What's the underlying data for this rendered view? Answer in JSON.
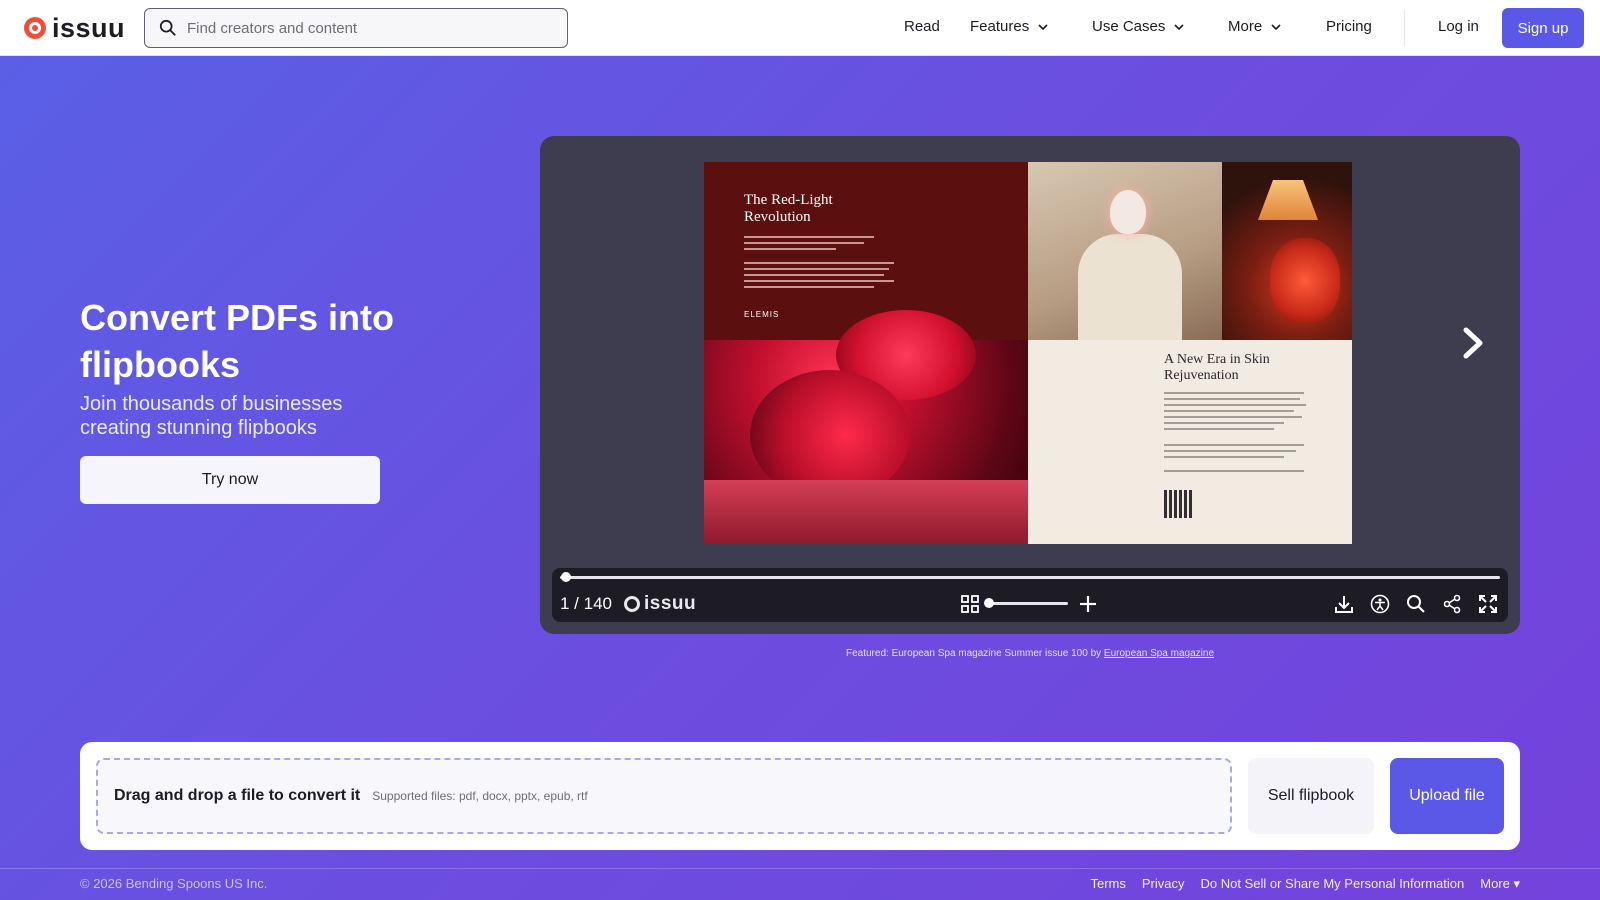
{
  "header": {
    "logo_text": "issuu",
    "search_placeholder": "Find creators and content",
    "nav": {
      "read": "Read",
      "features": "Features",
      "use_cases": "Use Cases",
      "more": "More",
      "pricing": "Pricing",
      "login": "Log in",
      "signup": "Sign up"
    }
  },
  "hero": {
    "title": "Convert PDFs into flipbooks",
    "subtitle": "Join thousands of businesses creating stunning flipbooks",
    "cta": "Try now"
  },
  "viewer": {
    "page_left_title": "The Red-Light Revolution",
    "page_left_brand": "ELEMIS",
    "page_right_title": "A New Era in Skin Rejuvenation",
    "page_count": "1 / 140",
    "logo_text": "issuu",
    "progress_fraction": 0.007
  },
  "featured": {
    "prefix": "Featured: European Spa magazine Summer issue 100 by",
    "link": "European Spa magazine"
  },
  "upload": {
    "drop_title": "Drag and drop a file to convert it",
    "drop_sub": "Supported files: pdf, docx, pptx, epub, rtf",
    "sell_label": "Sell flipbook",
    "upload_label": "Upload file"
  },
  "footer": {
    "copyright": "© 2026 Bending Spoons US Inc.",
    "terms": "Terms",
    "privacy": "Privacy",
    "do_not_sell": "Do Not Sell or Share My Personal Information",
    "more": "More ▾"
  },
  "colors": {
    "accent": "#5b58e8",
    "logo": "#f04e37",
    "hero_bg": "#6a4fe0"
  }
}
